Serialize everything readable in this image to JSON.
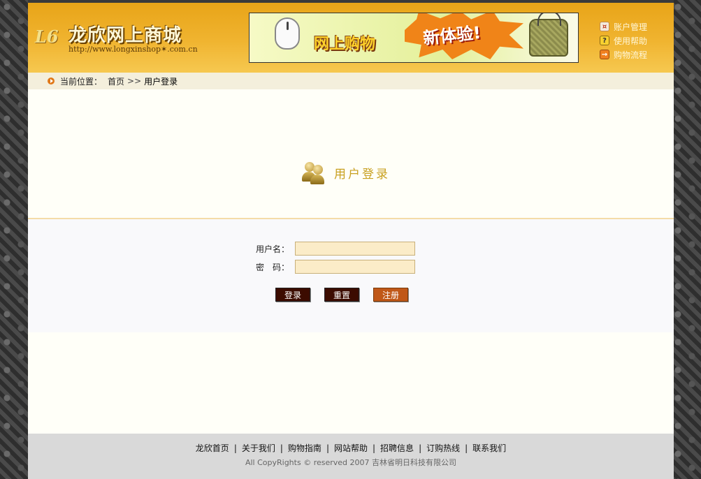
{
  "header": {
    "logo_mark": "L6",
    "logo_title": "龙欣网上商城",
    "logo_url": "http://www.longxinshop✶.com.cn",
    "banner_text_left": "网上购物",
    "banner_text_right": "新体验!",
    "links": [
      {
        "label": "账户管理",
        "icon": "account-icon",
        "glyph": "¤"
      },
      {
        "label": "使用帮助",
        "icon": "help-icon",
        "glyph": "?"
      },
      {
        "label": "购物流程",
        "icon": "flow-icon",
        "glyph": "→"
      }
    ]
  },
  "breadcrumb": {
    "label": "当前位置：",
    "home": "首页",
    "separator": ">>",
    "current": "用户登录"
  },
  "login": {
    "title": "用户登录",
    "username_label": "用户名：",
    "username_value": "",
    "password_label": "密　码：",
    "password_value": "",
    "buttons": {
      "login": "登录",
      "reset": "重置",
      "register": "注册"
    }
  },
  "footer": {
    "links": [
      "龙欣首页",
      "关于我们",
      "购物指南",
      "网站帮助",
      "招聘信息",
      "订购热线",
      "联系我们"
    ],
    "separator": "|",
    "copyright": "All CopyRights © reserved 2007 吉林省明日科技有限公司"
  },
  "colors": {
    "header_orange": "#f0b430",
    "title_gold": "#c8a020",
    "input_bg": "#fbecc8",
    "button_dark": "#3c0c00",
    "button_orange": "#c05818"
  }
}
